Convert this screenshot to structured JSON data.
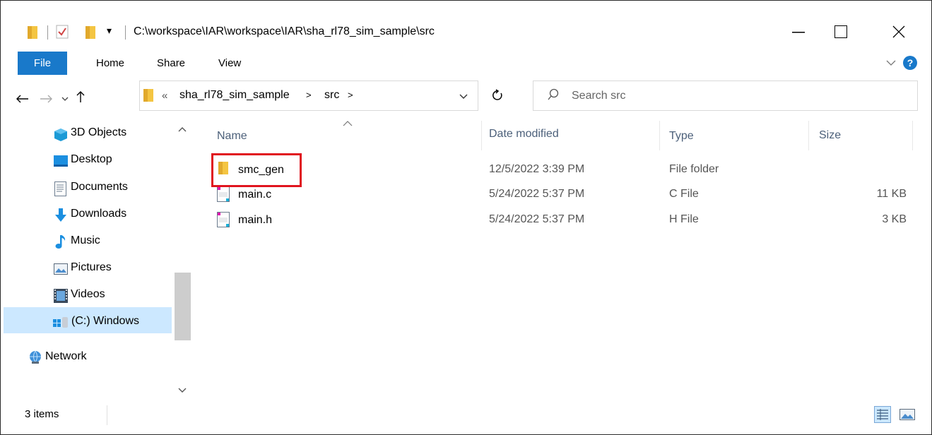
{
  "title": {
    "path": "C:\\workspace\\IAR\\workspace\\IAR\\sha_rl78_sim_sample\\src"
  },
  "ribbon": {
    "tabs": [
      "File",
      "Home",
      "Share",
      "View"
    ]
  },
  "address": {
    "crumbs": [
      "sha_rl78_sim_sample",
      "src"
    ],
    "overflow": "«"
  },
  "search": {
    "placeholder": "Search src"
  },
  "sidebar": {
    "items": [
      {
        "label": "3D Objects",
        "icon": "3d-objects-icon"
      },
      {
        "label": "Desktop",
        "icon": "desktop-icon"
      },
      {
        "label": "Documents",
        "icon": "documents-icon"
      },
      {
        "label": "Downloads",
        "icon": "downloads-icon"
      },
      {
        "label": "Music",
        "icon": "music-icon"
      },
      {
        "label": "Pictures",
        "icon": "pictures-icon"
      },
      {
        "label": "Videos",
        "icon": "videos-icon"
      },
      {
        "label": "(C:) Windows",
        "icon": "drive-icon",
        "selected": true
      },
      {
        "label": "Network",
        "icon": "network-icon"
      }
    ]
  },
  "columns": {
    "name": "Name",
    "date": "Date modified",
    "type": "Type",
    "size": "Size"
  },
  "files": [
    {
      "name": "smc_gen",
      "date": "12/5/2022 3:39 PM",
      "type": "File folder",
      "size": "",
      "icon": "folder-icon"
    },
    {
      "name": "main.c",
      "date": "5/24/2022 5:37 PM",
      "type": "C File",
      "size": "11 KB",
      "icon": "c-file-icon"
    },
    {
      "name": "main.h",
      "date": "5/24/2022 5:37 PM",
      "type": "H File",
      "size": "3 KB",
      "icon": "h-file-icon"
    }
  ],
  "status": {
    "count": "3 items"
  },
  "colors": {
    "accent": "#1979ca",
    "highlight": "#e0141e",
    "selection": "#cce8ff"
  }
}
